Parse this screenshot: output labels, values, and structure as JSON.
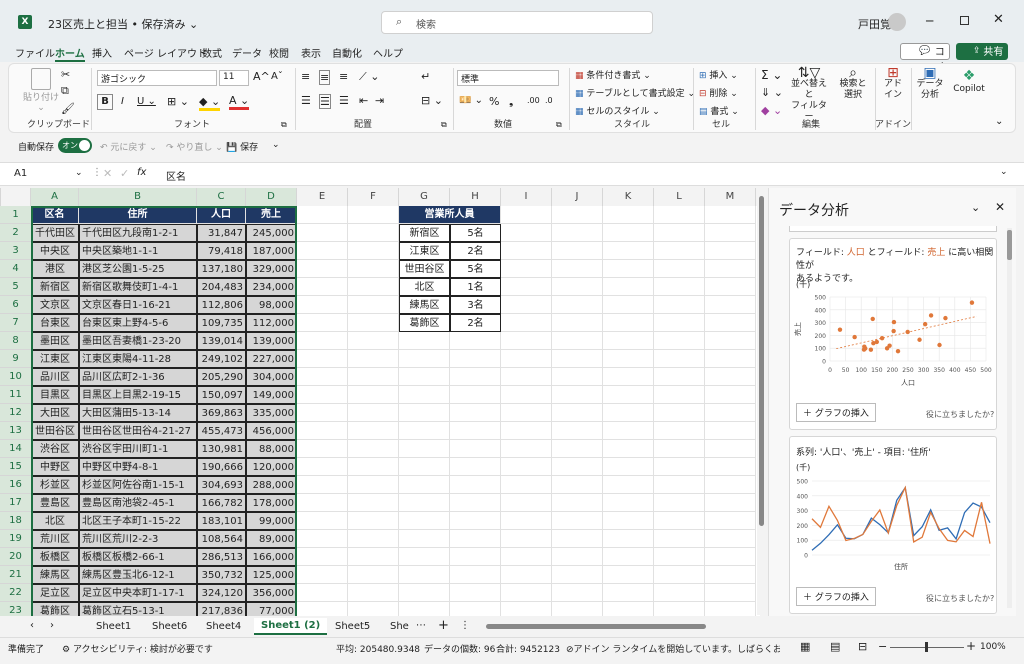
{
  "title": {
    "doc": "23区売上と担当 • 保存済み ⌄",
    "search": "検索",
    "user": "戸田覚"
  },
  "menu": [
    "ファイル",
    "ホーム",
    "挿入",
    "ページ レイアウト",
    "数式",
    "データ",
    "校閲",
    "表示",
    "自動化",
    "ヘルプ"
  ],
  "buttons": {
    "comment": "コメント",
    "share": "共有"
  },
  "ribbon": {
    "clipboard": {
      "paste": "貼り付け",
      "group": "クリップボード"
    },
    "font": {
      "name": "游ゴシック",
      "size": "11",
      "group": "フォント"
    },
    "align": {
      "group": "配置"
    },
    "number": {
      "format": "標準",
      "group": "数値"
    },
    "style": {
      "cond": "条件付き書式 ⌄",
      "table": "テーブルとして書式設定 ⌄",
      "cell": "セルのスタイル ⌄",
      "group": "スタイル"
    },
    "cells": {
      "insert": "挿入",
      "delete": "削除",
      "format": "書式",
      "group": "セル"
    },
    "edit": {
      "sort": "並べ替えと\nフィルター",
      "find": "検索と\n選択",
      "group": "編集"
    },
    "addin": {
      "addin": "アド\nイン",
      "analyze": "データ\n分析",
      "copilot": "Copilot",
      "group": "アドイン"
    }
  },
  "qat": {
    "autosave": "自動保存",
    "toggle": "オン",
    "undo": "元に戻す",
    "redo": "やり直し",
    "save": "保存"
  },
  "formula": {
    "cell": "A1",
    "fx": "fx",
    "value": "区名"
  },
  "columns": [
    "A",
    "B",
    "C",
    "D",
    "E",
    "F",
    "G",
    "H",
    "I",
    "J",
    "K",
    "L",
    "M"
  ],
  "table": {
    "headers": [
      "区名",
      "住所",
      "人口",
      "売上"
    ],
    "rows": [
      [
        "千代田区",
        "千代田区九段南1-2-1",
        "31,847",
        "245,000"
      ],
      [
        "中央区",
        "中央区築地1-1-1",
        "79,418",
        "187,000"
      ],
      [
        "港区",
        "港区芝公園1-5-25",
        "137,180",
        "329,000"
      ],
      [
        "新宿区",
        "新宿区歌舞伎町1-4-1",
        "204,483",
        "234,000"
      ],
      [
        "文京区",
        "文京区春日1-16-21",
        "112,806",
        "98,000"
      ],
      [
        "台東区",
        "台東区東上野4-5-6",
        "109,735",
        "112,000"
      ],
      [
        "墨田区",
        "墨田区吾妻橋1-23-20",
        "139,014",
        "139,000"
      ],
      [
        "江東区",
        "江東区東陽4-11-28",
        "249,102",
        "227,000"
      ],
      [
        "品川区",
        "品川区広町2-1-36",
        "205,290",
        "304,000"
      ],
      [
        "目黒区",
        "目黒区上目黒2-19-15",
        "150,097",
        "149,000"
      ],
      [
        "大田区",
        "大田区蒲田5-13-14",
        "369,863",
        "335,000"
      ],
      [
        "世田谷区",
        "世田谷区世田谷4-21-27",
        "455,473",
        "456,000"
      ],
      [
        "渋谷区",
        "渋谷区宇田川町1-1",
        "130,981",
        "88,000"
      ],
      [
        "中野区",
        "中野区中野4-8-1",
        "190,666",
        "120,000"
      ],
      [
        "杉並区",
        "杉並区阿佐谷南1-15-1",
        "304,693",
        "288,000"
      ],
      [
        "豊島区",
        "豊島区南池袋2-45-1",
        "166,782",
        "178,000"
      ],
      [
        "北区",
        "北区王子本町1-15-22",
        "183,101",
        "99,000"
      ],
      [
        "荒川区",
        "荒川区荒川2-2-3",
        "108,564",
        "89,000"
      ],
      [
        "板橋区",
        "板橋区板橋2-66-1",
        "286,513",
        "166,000"
      ],
      [
        "練馬区",
        "練馬区豊玉北6-12-1",
        "350,732",
        "125,000"
      ],
      [
        "足立区",
        "足立区中央本町1-17-1",
        "324,120",
        "356,000"
      ],
      [
        "葛飾区",
        "葛飾区立石5-13-1",
        "217,836",
        "77,000"
      ]
    ]
  },
  "office": {
    "header": "営業所人員",
    "rows": [
      [
        "新宿区",
        "5名"
      ],
      [
        "江東区",
        "2名"
      ],
      [
        "世田谷区",
        "5名"
      ],
      [
        "北区",
        "1名"
      ],
      [
        "練馬区",
        "3名"
      ],
      [
        "葛飾区",
        "2名"
      ]
    ]
  },
  "sheets": [
    "Sheet1",
    "Sheet6",
    "Sheet4",
    "Sheet1 (2)",
    "Sheet5",
    "She"
  ],
  "status": {
    "ready": "準備完了",
    "access": "アクセシビリティ: 検討が必要です",
    "avg": "平均: 205480.9348",
    "count": "データの個数: 96",
    "sum": "合計: 9452123",
    "addin": "アドイン ランタイムを開始しています。しばらくお待ちください...",
    "zoom": "100%"
  },
  "pane": {
    "title": "データ分析",
    "card1": {
      "text_a": "フィールド: ",
      "f1": "人口",
      "text_b": " とフィールド: ",
      "f2": "売上",
      "text_c": " に高い相関性が",
      "text_d": "あるようです。",
      "unit": "(千)",
      "ylabel": "売上",
      "xlabel": "人口",
      "insert": "グラフの挿入",
      "helpful": "役に立ちましたか?"
    },
    "card2": {
      "text": "系列: '人口'、'売上' - 項目: '住所'",
      "unit": "(千)",
      "xlabel": "住所",
      "insert": "グラフの挿入",
      "helpful": "役に立ちましたか?"
    }
  },
  "chart_data": [
    {
      "type": "scatter",
      "x": [
        32,
        79,
        137,
        204,
        113,
        110,
        139,
        249,
        205,
        150,
        370,
        455,
        131,
        191,
        305,
        167,
        183,
        109,
        287,
        351,
        324,
        218
      ],
      "y": [
        245,
        187,
        329,
        234,
        98,
        112,
        139,
        227,
        304,
        149,
        335,
        456,
        88,
        120,
        288,
        178,
        99,
        89,
        166,
        125,
        356,
        77
      ],
      "xlabel": "人口",
      "ylabel": "売上",
      "xticks": [
        0,
        50,
        100,
        150,
        200,
        250,
        300,
        350,
        400,
        450,
        500
      ],
      "yticks": [
        0,
        100,
        200,
        300,
        400,
        500
      ],
      "xlim": [
        0,
        500
      ],
      "ylim": [
        0,
        500
      ],
      "trendline": true,
      "color": "#e0783a"
    },
    {
      "type": "line",
      "series": [
        {
          "name": "人口",
          "values": [
            32,
            79,
            137,
            204,
            113,
            110,
            139,
            249,
            205,
            150,
            370,
            455,
            131,
            191,
            305,
            167,
            183,
            109,
            287,
            351,
            324,
            218
          ],
          "color": "#2f6db5"
        },
        {
          "name": "売上",
          "values": [
            245,
            187,
            329,
            234,
            98,
            112,
            139,
            227,
            304,
            149,
            335,
            456,
            88,
            120,
            288,
            178,
            99,
            89,
            166,
            125,
            356,
            77
          ],
          "color": "#e0783a"
        }
      ],
      "xlabel": "住所",
      "yticks": [
        0,
        100,
        200,
        300,
        400,
        500
      ],
      "ylim": [
        0,
        500
      ]
    }
  ]
}
